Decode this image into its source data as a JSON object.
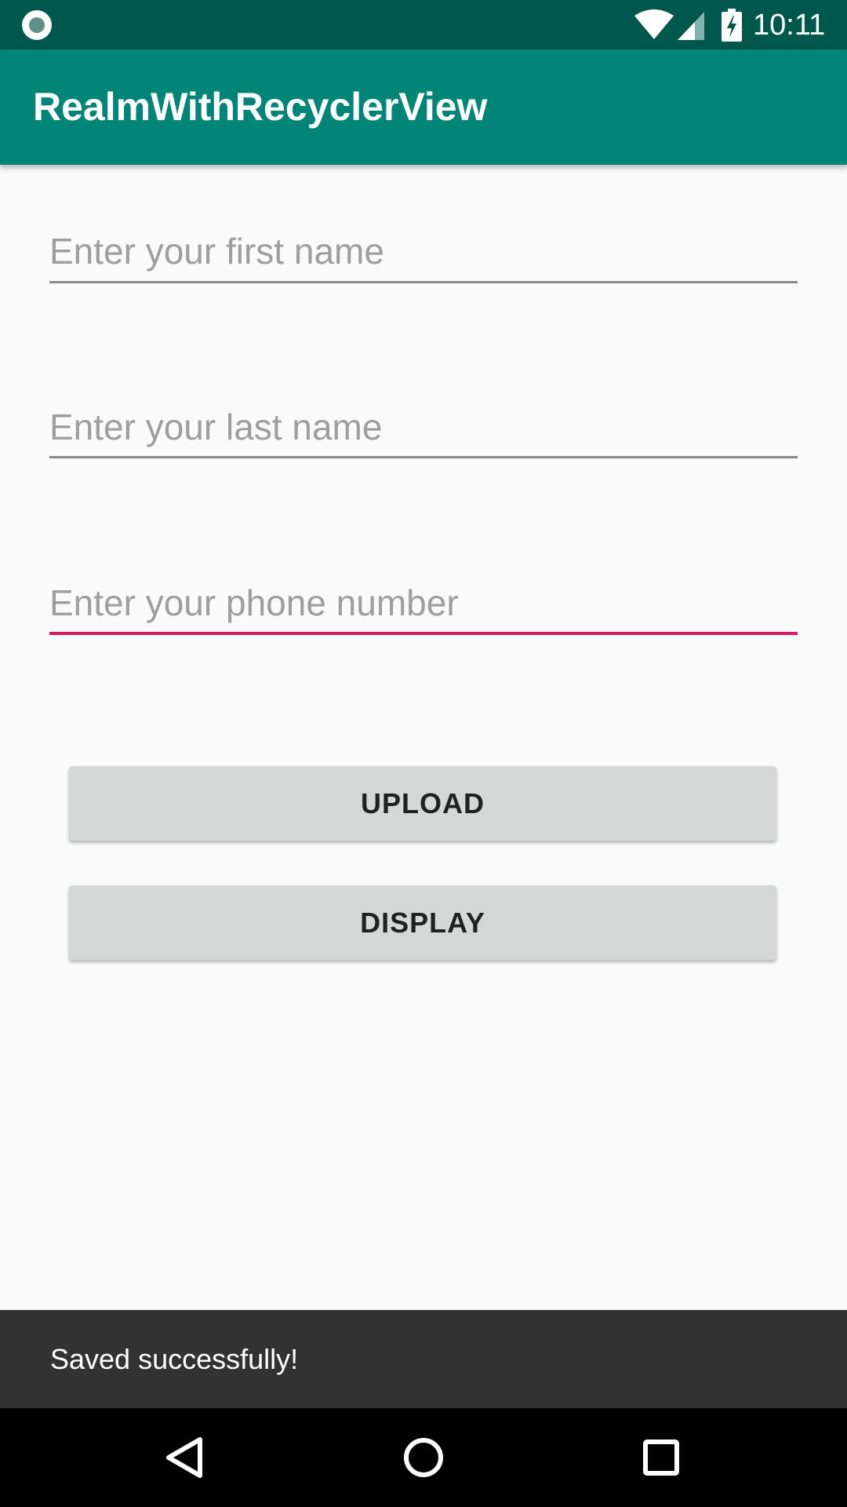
{
  "status_bar": {
    "time": "10:11",
    "icons": [
      "notification-dot-icon",
      "wifi-icon",
      "cell-signal-icon",
      "battery-charging-icon"
    ]
  },
  "app_bar": {
    "title": "RealmWithRecyclerView",
    "color": "#008577"
  },
  "form": {
    "first_name": {
      "placeholder": "Enter your first name",
      "value": ""
    },
    "last_name": {
      "placeholder": "Enter your last name",
      "value": ""
    },
    "phone_number": {
      "placeholder": "Enter your phone number",
      "value": ""
    }
  },
  "buttons": {
    "upload_label": "UPLOAD",
    "display_label": "DISPLAY"
  },
  "snackbar": {
    "message": "Saved successfully!"
  },
  "nav_bar": {
    "icons": [
      "back-icon",
      "home-icon",
      "recents-icon"
    ]
  },
  "colors": {
    "status_bar": "#00574b",
    "accent": "#d81b60",
    "background": "#fafafa",
    "button": "#d6d7d7",
    "snackbar": "#323232"
  }
}
